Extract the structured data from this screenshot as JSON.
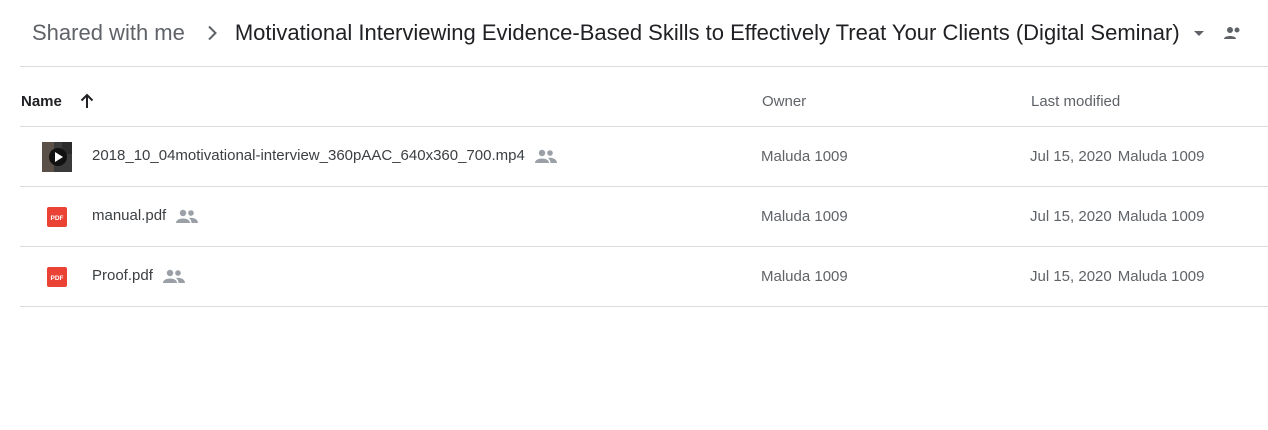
{
  "breadcrumb": {
    "root_label": "Shared with me",
    "current_folder": "Motivational Interviewing Evidence-Based Skills to Effectively Treat Your Clients (Digital Seminar)"
  },
  "table": {
    "headers": {
      "name": "Name",
      "owner": "Owner",
      "last_modified": "Last modified"
    },
    "sort": {
      "column": "Name",
      "direction": "ascending"
    },
    "rows": [
      {
        "file_type": "video",
        "icon": "video-play-icon",
        "name": "2018_10_04motivational-interview_360pAAC_640x360_700.mp4",
        "shared": true,
        "owner": "Maluda 1009",
        "modified_date": "Jul 15, 2020",
        "modified_by": "Maluda 1009"
      },
      {
        "file_type": "pdf",
        "icon": "pdf-icon",
        "icon_text": "PDF",
        "name": "manual.pdf",
        "shared": true,
        "owner": "Maluda 1009",
        "modified_date": "Jul 15, 2020",
        "modified_by": "Maluda 1009"
      },
      {
        "file_type": "pdf",
        "icon": "pdf-icon",
        "icon_text": "PDF",
        "name": "Proof.pdf",
        "shared": true,
        "owner": "Maluda 1009",
        "modified_date": "Jul 15, 2020",
        "modified_by": "Maluda 1009"
      }
    ]
  },
  "colors": {
    "pdf_red": "#ea4335",
    "divider": "#dadce0",
    "secondary_text": "#5f6368",
    "icon_grey": "#9aa0a6"
  }
}
